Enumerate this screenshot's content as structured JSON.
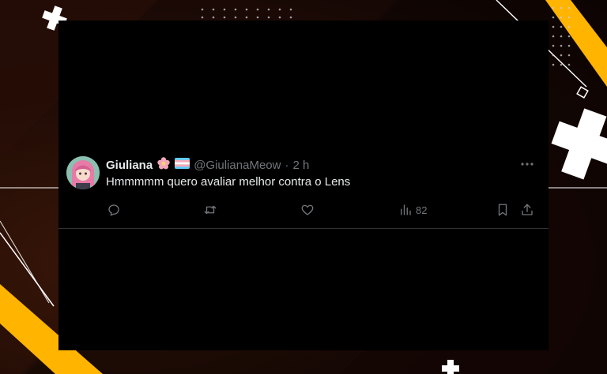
{
  "tweet": {
    "display_name": "Giuliana",
    "handle": "@GiulianaMeow",
    "separator": "·",
    "time": "2 h",
    "text": "Hmmmmm quero avaliar melhor contra o Lens",
    "views_count": "82"
  },
  "colors": {
    "background_dark": "#1c0c07",
    "accent_yellow": "#ffb400",
    "card": "#000000",
    "text_primary": "#e7e9ea",
    "text_secondary": "#71767b"
  },
  "icons": [
    "flower-emoji-icon",
    "trans-flag-icon",
    "more-icon",
    "reply-icon",
    "retweet-icon",
    "like-icon",
    "views-icon",
    "bookmark-icon",
    "share-icon"
  ]
}
